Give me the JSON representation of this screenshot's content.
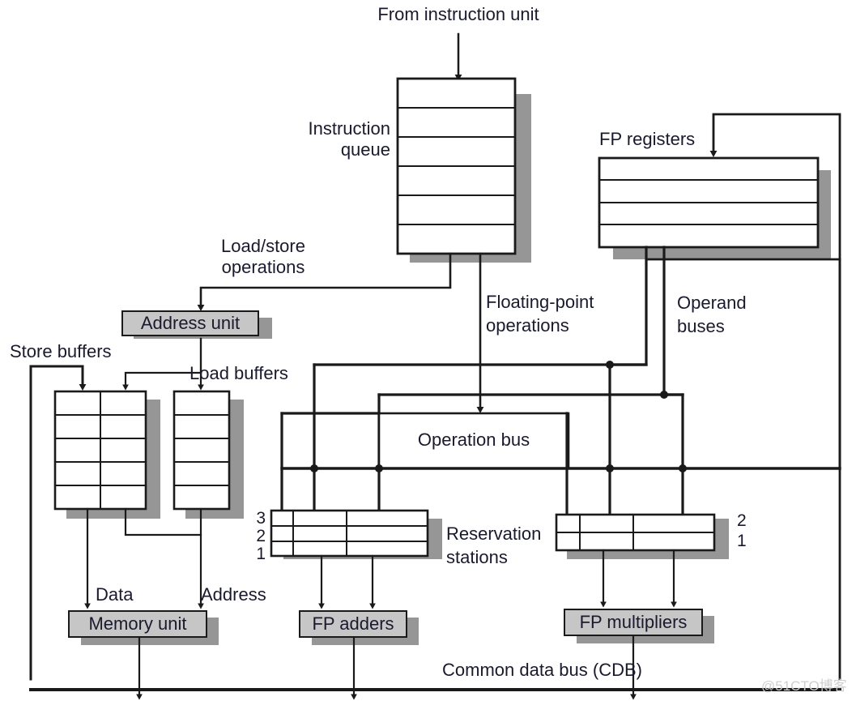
{
  "diagram": {
    "title": "Tomasulo-style dynamic scheduling hardware organization",
    "watermark": "@51CTO博客",
    "labels": {
      "from_instruction_unit": "From instruction unit",
      "instruction_queue_line1": "Instruction",
      "instruction_queue_line2": "queue",
      "fp_registers": "FP registers",
      "load_store_ops_line1": "Load/store",
      "load_store_ops_line2": "operations",
      "floating_point_ops_line1": "Floating-point",
      "floating_point_ops_line2": "operations",
      "operand_buses_line1": "Operand",
      "operand_buses_line2": "buses",
      "address_unit": "Address unit",
      "store_buffers": "Store buffers",
      "load_buffers": "Load buffers",
      "operation_bus": "Operation bus",
      "reservation_stations_line1": "Reservation",
      "reservation_stations_line2": "stations",
      "data": "Data",
      "address": "Address",
      "memory_unit": "Memory unit",
      "fp_adders": "FP adders",
      "fp_multipliers": "FP multipliers",
      "common_data_bus": "Common data bus (CDB)"
    },
    "reservation_station_numbers": {
      "adder_rows": [
        "3",
        "2",
        "1"
      ],
      "multiplier_rows": [
        "2",
        "1"
      ]
    },
    "structures": {
      "instruction_queue_rows": 6,
      "fp_registers_rows": 4,
      "store_buffer_rows": 5,
      "store_buffer_cols": 2,
      "load_buffer_rows": 5,
      "load_buffer_cols": 1,
      "adder_rs_rows": 3,
      "adder_rs_cols": 3,
      "multiplier_rs_rows": 2,
      "multiplier_rs_cols": 3
    },
    "colors": {
      "line": "#1a1a1a",
      "box_fill": "#ffffff",
      "unit_fill": "#c6c6c6",
      "shadow": "#969696",
      "text": "#1a1a2e",
      "background": "#ffffff",
      "watermark": "#cfcfcf"
    }
  }
}
